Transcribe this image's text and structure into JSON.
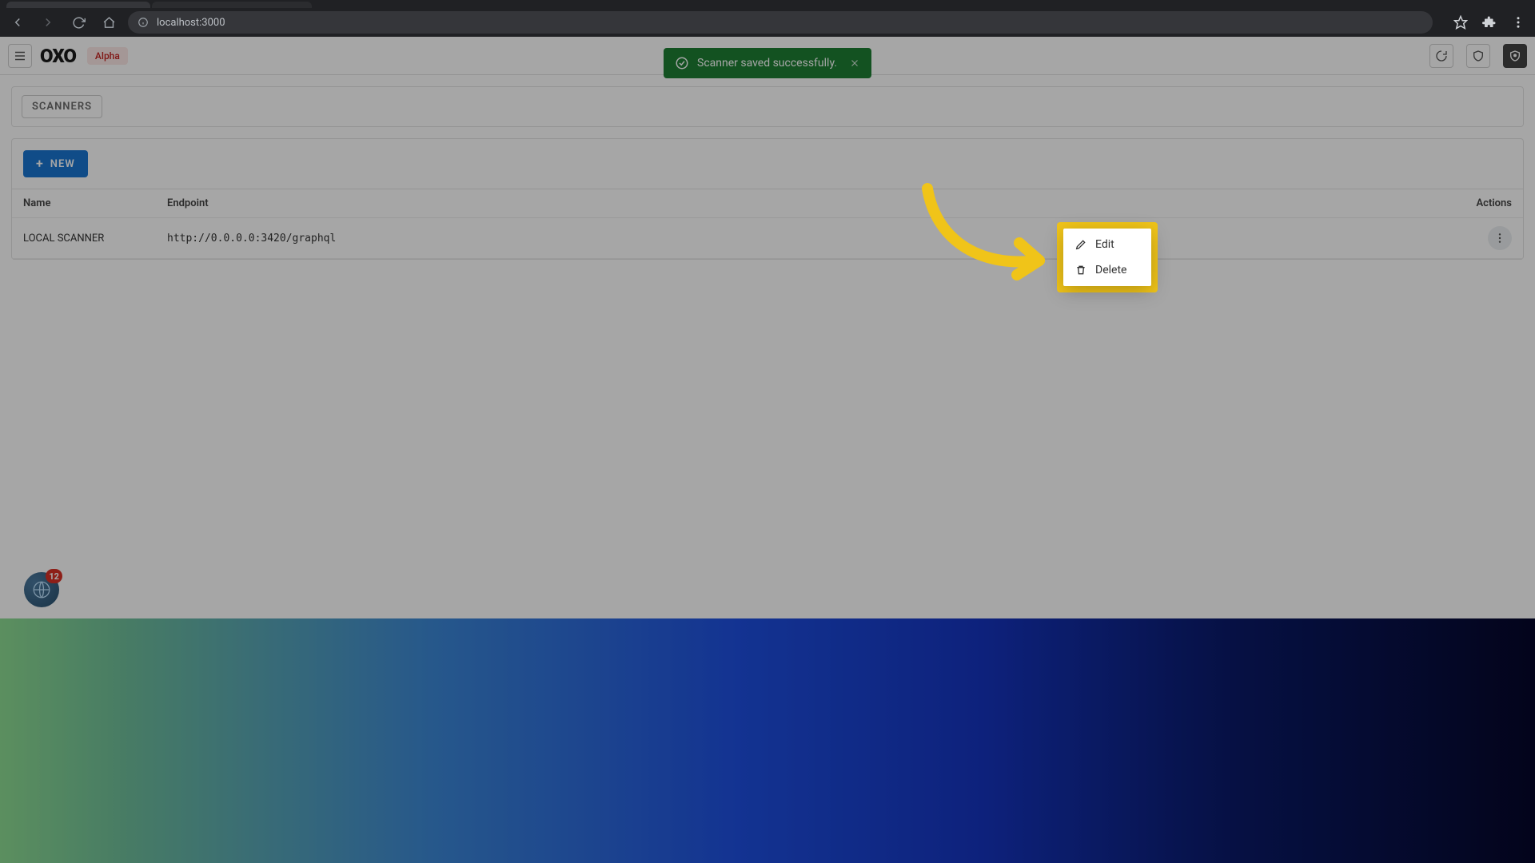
{
  "browser": {
    "url": "localhost:3000"
  },
  "header": {
    "logo": "OXO",
    "badge": "Alpha"
  },
  "toast": {
    "message": "Scanner saved successfully."
  },
  "breadcrumb": {
    "current": "SCANNERS"
  },
  "toolbar": {
    "new_label": "NEW"
  },
  "table": {
    "columns": {
      "name": "Name",
      "endpoint": "Endpoint",
      "actions": "Actions"
    },
    "rows": [
      {
        "name": "LOCAL SCANNER",
        "endpoint": "http://0.0.0.0:3420/graphql"
      }
    ]
  },
  "context_menu": {
    "edit": "Edit",
    "delete": "Delete"
  },
  "dev_bubble": {
    "count": "12"
  },
  "colors": {
    "primary": "#1976d2",
    "toast_bg": "#1e7e34",
    "highlight": "#f0c419",
    "alpha_bg": "#fce8e6",
    "alpha_fg": "#c5221f"
  }
}
